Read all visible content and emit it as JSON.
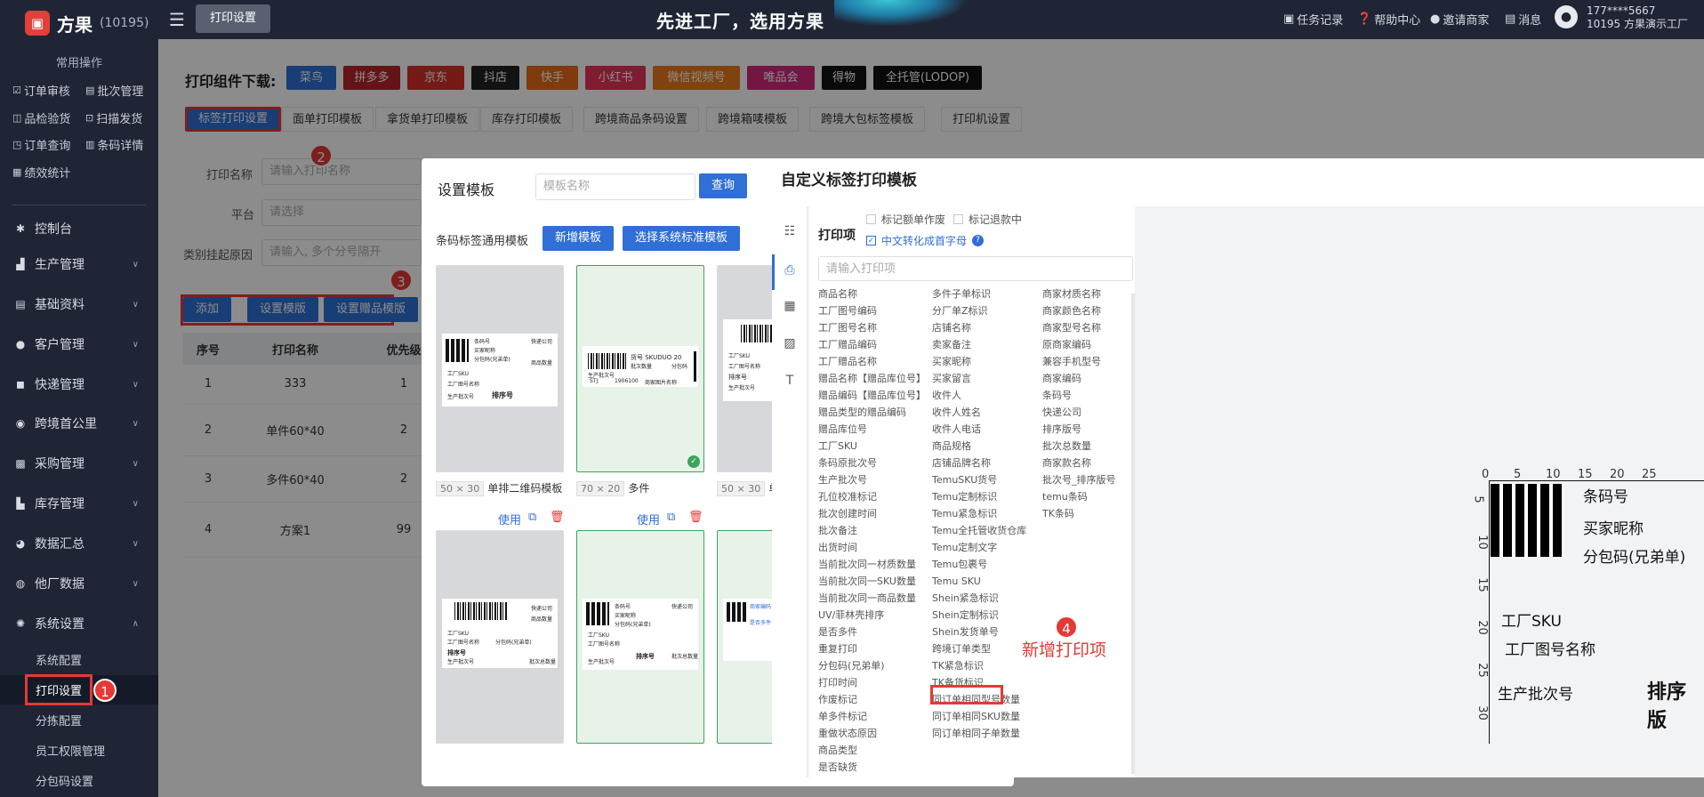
{
  "app": {
    "name": "方果",
    "account_no": "(10195)"
  },
  "sidebar": {
    "section_title": "常用操作",
    "quick": [
      {
        "label": "订单审核",
        "icon": "check-square-icon"
      },
      {
        "label": "批次管理",
        "icon": "document-icon"
      },
      {
        "label": "品检验货",
        "icon": "box-icon"
      },
      {
        "label": "扫描发货",
        "icon": "scan-icon"
      },
      {
        "label": "订单查询",
        "icon": "search-doc-icon"
      },
      {
        "label": "条码详情",
        "icon": "barcode-icon"
      },
      {
        "label": "绩效统计",
        "icon": "chart-icon"
      }
    ],
    "menus": [
      {
        "label": "控制台",
        "icon": "dashboard-icon"
      },
      {
        "label": "生产管理",
        "icon": "factory-icon"
      },
      {
        "label": "基础资料",
        "icon": "database-icon"
      },
      {
        "label": "客户管理",
        "icon": "user-icon"
      },
      {
        "label": "快递管理",
        "icon": "truck-icon"
      },
      {
        "label": "跨境首公里",
        "icon": "globe-icon"
      },
      {
        "label": "采购管理",
        "icon": "cart-icon"
      },
      {
        "label": "库存管理",
        "icon": "warehouse-icon"
      },
      {
        "label": "数据汇总",
        "icon": "pie-icon"
      },
      {
        "label": "他厂数据",
        "icon": "share-icon"
      },
      {
        "label": "系统设置",
        "icon": "settings-icon"
      }
    ],
    "submenus": [
      "系统配置",
      "打印设置",
      "分拣配置",
      "员工权限管理",
      "分包码设置"
    ]
  },
  "topbar": {
    "tab": "打印设置",
    "slogan": "先进工厂，选用方果",
    "items": [
      "任务记录",
      "帮助中心",
      "邀请商家",
      "消息"
    ],
    "user_phone": "177****5667",
    "user_name": "10195  方果演示工厂"
  },
  "main": {
    "download_label": "打印组件下载:",
    "download_buttons": [
      {
        "label": "菜鸟",
        "color": "#2f6fd6"
      },
      {
        "label": "拼多多",
        "color": "#b7262b"
      },
      {
        "label": "京东",
        "color": "#d6302b"
      },
      {
        "label": "抖店",
        "color": "#222222"
      },
      {
        "label": "快手",
        "color": "#e86a1a"
      },
      {
        "label": "小红书",
        "color": "#e8345a"
      },
      {
        "label": "微信视频号",
        "color": "#ea7b1d"
      },
      {
        "label": "唯品会",
        "color": "#d1287a"
      },
      {
        "label": "得物",
        "color": "#111111"
      },
      {
        "label": "全托管(LODOP)",
        "color": "#111111"
      }
    ],
    "subtabs": [
      "标签打印设置",
      "面单打印模板",
      "拿货单打印模板",
      "库存打印模板",
      "跨境商品条码设置",
      "跨境箱唛模板",
      "跨境大包标签模板",
      "打印机设置"
    ],
    "filters": {
      "name_label": "打印名称",
      "name_placeholder": "请输入打印名称",
      "platform_label": "平台",
      "platform_placeholder": "请选择",
      "reason_label": "类别挂起原因",
      "reason_placeholder": "请输入, 多个分号隔开"
    },
    "actions": {
      "add": "添加",
      "set_template": "设置模版",
      "gift_template": "设置赠品模版"
    },
    "table": {
      "headers": [
        "序号",
        "打印名称",
        "优先级"
      ],
      "rows": [
        [
          "1",
          "333",
          "1"
        ],
        [
          "2",
          "单件60*40",
          "2"
        ],
        [
          "3",
          "多件60*40",
          "2"
        ],
        [
          "4",
          "方案1",
          "99"
        ]
      ]
    },
    "badges": [
      "1",
      "2",
      "3",
      "4"
    ]
  },
  "dialog_templates": {
    "title": "设置模板",
    "search_placeholder": "模板名称",
    "search_button": "查询",
    "category": "条码标签通用模板",
    "new_button": "新增模板",
    "select_button": "选择系统标准模板",
    "cards": [
      {
        "size": "50 × 30",
        "name": "单排二维码模板"
      },
      {
        "size": "70 × 20",
        "name": "多件"
      },
      {
        "size": "50 × 30",
        "name": "单"
      }
    ],
    "use_label": "使用",
    "label_texts": {
      "barcode": "条码号",
      "nickname": "买家昵称",
      "subcode": "分包码(兄弟单)",
      "express": "快递公司",
      "goods_qty": "商品数量",
      "sku": "工厂SKU",
      "pic_name": "工厂图号名称",
      "batch": "生产批次号",
      "sort": "排序号",
      "batch_qty": "批次总数量",
      "cn_sku": "货号 SKUDUO 20",
      "batch_qty2": "批次数量",
      "sub": "分包码",
      "stj": "STJ",
      "code_val": "1906100",
      "merchant_pic": "商家图片名称",
      "merchant_code": "商家编码",
      "pick_qty": "是否多件"
    }
  },
  "dialog_custom": {
    "title": "自定义标签打印模板",
    "section": "打印项",
    "check1": "标记额单作废",
    "check2": "标记退款中",
    "check3": "中文转化成首字母",
    "search_placeholder": "请输入打印项",
    "col1": [
      "商品名称",
      "工厂图号编码",
      "工厂图号名称",
      "工厂赠品编码",
      "工厂赠品名称",
      "赠品名称【赠品库位号】",
      "赠品编码【赠品库位号】",
      "赠品类型的赠品编码",
      "赠品库位号",
      "工厂SKU",
      "条码原批次号",
      "生产批次号",
      "孔位校准标记",
      "批次创建时间",
      "批次备注",
      "出货时间",
      "当前批次同一材质数量",
      "当前批次同一SKU数量",
      "当前批次同一商品数量",
      "UV/菲林壳排序",
      "是否多件",
      "重复打印",
      "分包码(兄弟单)",
      "打印时间",
      "作废标记",
      "单多件标记",
      "重做状态原因",
      "商品类型",
      "是否缺货"
    ],
    "col2": [
      "多件子单标识",
      "分厂单Z标识",
      "店铺名称",
      "卖家备注",
      "买家昵称",
      "买家留言",
      "收件人",
      "收件人姓名",
      "收件人电话",
      "商品规格",
      "店铺品牌名称",
      "TemuSKU货号",
      "Temu定制标识",
      "Temu紧急标识",
      "Temu全托管收货仓库",
      "Temu定制文字",
      "Temu包裹号",
      "Temu SKU",
      "Shein紧急标识",
      "Shein定制标识",
      "Shein发货单号",
      "跨境订单类型",
      "TK紧急标识",
      "TK备货标识",
      "同订单相同型号数量",
      "同订单相同SKU数量",
      "同订单相同子单数量"
    ],
    "col3": [
      "商家材质名称",
      "商家颜色名称",
      "商家型号名称",
      "原商家编码",
      "兼容手机型号",
      "商家编码",
      "条码号",
      "快递公司",
      "排序版号",
      "批次总数量",
      "商家款名称",
      "批次号_排序版号",
      "temu条码",
      "TK条码"
    ],
    "new_item_note": "新增打印项",
    "preview": {
      "ruler": [
        "0",
        "5",
        "10",
        "15",
        "20",
        "25"
      ],
      "barcode": "条码号",
      "nickname": "买家昵称",
      "subcode": "分包码(兄弟单)",
      "sku": "工厂SKU",
      "pic_name": "工厂图号名称",
      "batch": "生产批次号",
      "sort": "排序版"
    }
  }
}
